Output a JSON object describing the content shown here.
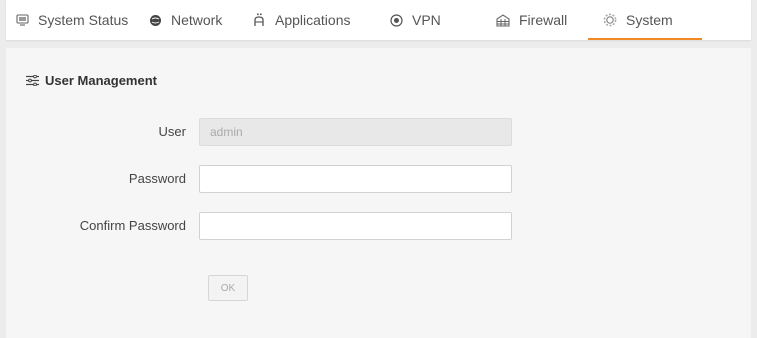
{
  "nav": {
    "items": [
      {
        "label": "System Status",
        "icon": "monitor-icon"
      },
      {
        "label": "Network",
        "icon": "globe-icon"
      },
      {
        "label": "Applications",
        "icon": "apps-icon"
      },
      {
        "label": "VPN",
        "icon": "vpn-icon"
      },
      {
        "label": "Firewall",
        "icon": "firewall-icon"
      },
      {
        "label": "System",
        "icon": "gear-icon",
        "active": true
      }
    ],
    "active_color": "#f08a24"
  },
  "section": {
    "title": "User Management",
    "icon": "sliders-icon"
  },
  "form": {
    "user_label": "User",
    "user_value": "admin",
    "password_label": "Password",
    "password_value": "",
    "confirm_label": "Confirm Password",
    "confirm_value": "",
    "ok_label": "OK"
  }
}
